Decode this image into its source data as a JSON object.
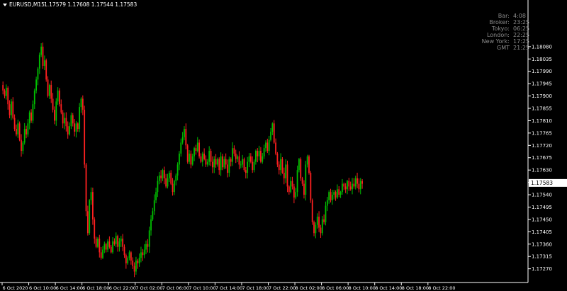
{
  "header": {
    "symbol_label": "EURUSD,M15",
    "ohlc": "1.17579 1.17608 1.17544 1.17583"
  },
  "info_panel": [
    {
      "label": "Bar:",
      "value": "4:08"
    },
    {
      "label": "Broker:",
      "value": "23:25"
    },
    {
      "label": "Tokyo:",
      "value": "06:25"
    },
    {
      "label": "London:",
      "value": "22:25"
    },
    {
      "label": "New York:",
      "value": "17:25"
    },
    {
      "label": "GMT",
      "value": "21:25"
    }
  ],
  "colors": {
    "background": "#000000",
    "bull": "#00c000",
    "bear": "#ff2020",
    "axis": "#ffffff",
    "info_text": "#8a8a8a"
  },
  "chart_data": {
    "type": "candlestick",
    "symbol": "EURUSD",
    "timeframe": "M15",
    "current_price": 1.17583,
    "current_price_label": "1.17583",
    "ylim": [
      1.1722,
      1.1825
    ],
    "y_ticks": [
      {
        "value": 1.1808,
        "label": "1.18080"
      },
      {
        "value": 1.18035,
        "label": "1.18035"
      },
      {
        "value": 1.1799,
        "label": "1.17990"
      },
      {
        "value": 1.17945,
        "label": "1.17945"
      },
      {
        "value": 1.179,
        "label": "1.17900"
      },
      {
        "value": 1.17855,
        "label": "1.17855"
      },
      {
        "value": 1.1781,
        "label": "1.17810"
      },
      {
        "value": 1.17765,
        "label": "1.17765"
      },
      {
        "value": 1.1772,
        "label": "1.17720"
      },
      {
        "value": 1.17675,
        "label": "1.17675"
      },
      {
        "value": 1.1763,
        "label": "1.17630"
      },
      {
        "value": 1.17585,
        "label": "1.17585"
      },
      {
        "value": 1.1754,
        "label": "1.17540"
      },
      {
        "value": 1.17495,
        "label": "1.17495"
      },
      {
        "value": 1.1745,
        "label": "1.17450"
      },
      {
        "value": 1.17405,
        "label": "1.17405"
      },
      {
        "value": 1.1736,
        "label": "1.17360"
      },
      {
        "value": 1.17315,
        "label": "1.17315"
      },
      {
        "value": 1.1727,
        "label": "1.17270"
      }
    ],
    "x_ticks": [
      "6 Oct 2020",
      "6 Oct 10:00",
      "6 Oct 14:00",
      "6 Oct 18:00",
      "6 Oct 22:00",
      "7 Oct 02:00",
      "7 Oct 06:00",
      "7 Oct 10:00",
      "7 Oct 14:00",
      "7 Oct 18:00",
      "7 Oct 22:00",
      "8 Oct 02:00",
      "8 Oct 06:00",
      "8 Oct 10:00",
      "8 Oct 14:00",
      "8 Oct 18:00",
      "8 Oct 22:00"
    ],
    "bars_per_tick": 16,
    "closes": [
      1.1792,
      1.179,
      1.1793,
      1.1787,
      1.1783,
      1.1788,
      1.1782,
      1.1778,
      1.1776,
      1.178,
      1.1774,
      1.177,
      1.1773,
      1.1778,
      1.1776,
      1.178,
      1.1784,
      1.1781,
      1.1787,
      1.1792,
      1.1796,
      1.18,
      1.1805,
      1.1808,
      1.1801,
      1.1803,
      1.1796,
      1.179,
      1.1794,
      1.1789,
      1.1785,
      1.1781,
      1.1788,
      1.1792,
      1.1787,
      1.1784,
      1.178,
      1.1782,
      1.1779,
      1.1776,
      1.1779,
      1.1783,
      1.178,
      1.1777,
      1.178,
      1.1778,
      1.1786,
      1.1789,
      1.1785,
      1.1765,
      1.1748,
      1.174,
      1.1752,
      1.1755,
      1.1745,
      1.1738,
      1.1735,
      1.1738,
      1.1733,
      1.1731,
      1.1734,
      1.1736,
      1.1734,
      1.1737,
      1.1735,
      1.1733,
      1.1737,
      1.1736,
      1.1739,
      1.1735,
      1.1737,
      1.1738,
      1.1735,
      1.1732,
      1.1729,
      1.1731,
      1.1733,
      1.173,
      1.1728,
      1.1726,
      1.173,
      1.1729,
      1.1731,
      1.1733,
      1.1732,
      1.1734,
      1.1736,
      1.1735,
      1.1741,
      1.1745,
      1.1748,
      1.1752,
      1.1755,
      1.1759,
      1.1761,
      1.176,
      1.1763,
      1.176,
      1.1757,
      1.176,
      1.1762,
      1.1758,
      1.1755,
      1.1759,
      1.1761,
      1.1765,
      1.1769,
      1.1773,
      1.1775,
      1.1778,
      1.1772,
      1.1766,
      1.1769,
      1.1765,
      1.1768,
      1.1771,
      1.177,
      1.1773,
      1.1768,
      1.1766,
      1.1769,
      1.1767,
      1.1765,
      1.1766,
      1.177,
      1.1766,
      1.1764,
      1.1767,
      1.1765,
      1.1767,
      1.1763,
      1.1768,
      1.1764,
      1.1767,
      1.1765,
      1.1762,
      1.1767,
      1.1766,
      1.1771,
      1.1769,
      1.1767,
      1.1768,
      1.1765,
      1.1765,
      1.1767,
      1.1763,
      1.1762,
      1.1766,
      1.1768,
      1.1766,
      1.1763,
      1.1766,
      1.177,
      1.1768,
      1.177,
      1.1766,
      1.1768,
      1.1771,
      1.1773,
      1.177,
      1.1774,
      1.1777,
      1.178,
      1.1773,
      1.1769,
      1.1765,
      1.1763,
      1.1767,
      1.1762,
      1.176,
      1.1765,
      1.1757,
      1.1755,
      1.1759,
      1.1757,
      1.1753,
      1.1755,
      1.1763,
      1.1767,
      1.176,
      1.1758,
      1.1754,
      1.1765,
      1.1768,
      1.1762,
      1.1752,
      1.1744,
      1.174,
      1.1743,
      1.1746,
      1.1742,
      1.174,
      1.1745,
      1.1744,
      1.175,
      1.1752,
      1.1755,
      1.1752,
      1.1754,
      1.1755,
      1.1753,
      1.1756,
      1.1754,
      1.1755,
      1.1758,
      1.1757,
      1.1756,
      1.1759,
      1.1757,
      1.1756,
      1.1758,
      1.1757,
      1.176,
      1.1758,
      1.1756,
      1.1759,
      1.1758
    ]
  }
}
